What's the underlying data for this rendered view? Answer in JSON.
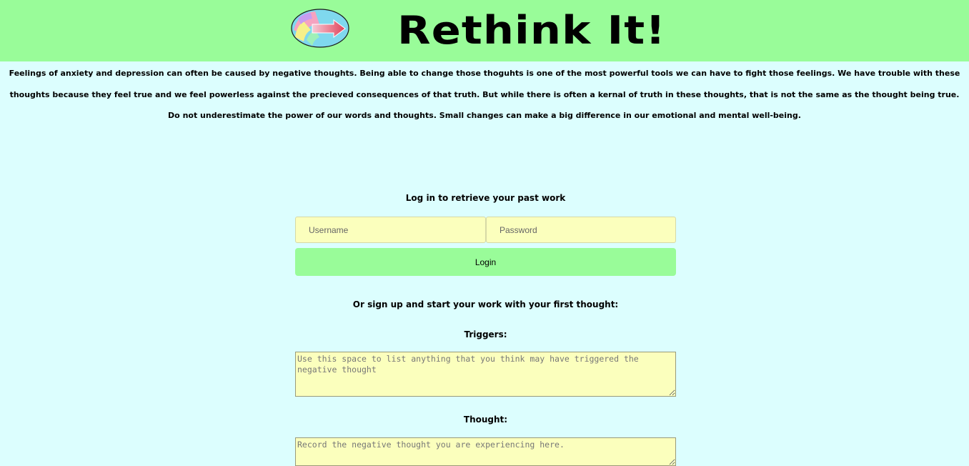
{
  "header": {
    "logo_icon": "rethink-logo-icon",
    "title": "Rethink It!",
    "background_color": "#99fc99"
  },
  "intro": {
    "text": "Feelings of anxiety and depression can often be caused by negative thoughts. Being able to change those thoguhts is one of the most powerful tools we can have to fight those feelings. We have trouble with these thoughts because they feel true and we feel powerless against the precieved consequences of that truth. But while there is often a kernal of truth in these thoughts, that is not the same as the thought being true. Do not underestimate the power of our words and thoughts. Small changes can make a big difference in our emotional and mental well-being."
  },
  "login": {
    "heading": "Log in to retrieve your past work",
    "username_placeholder": "Username",
    "password_placeholder": "Password",
    "button_label": "Login"
  },
  "signup": {
    "heading": "Or sign up and start your work with your first thought:",
    "triggers_label": "Triggers:",
    "triggers_placeholder": "Use this space to list anything that you think may have triggered the negative thought",
    "thought_label": "Thought:",
    "thought_placeholder": "Record the negative thought you are experiencing here."
  },
  "colors": {
    "page_background": "#dcfefe",
    "accent_green": "#99fc99",
    "input_background": "#fbffbd"
  }
}
